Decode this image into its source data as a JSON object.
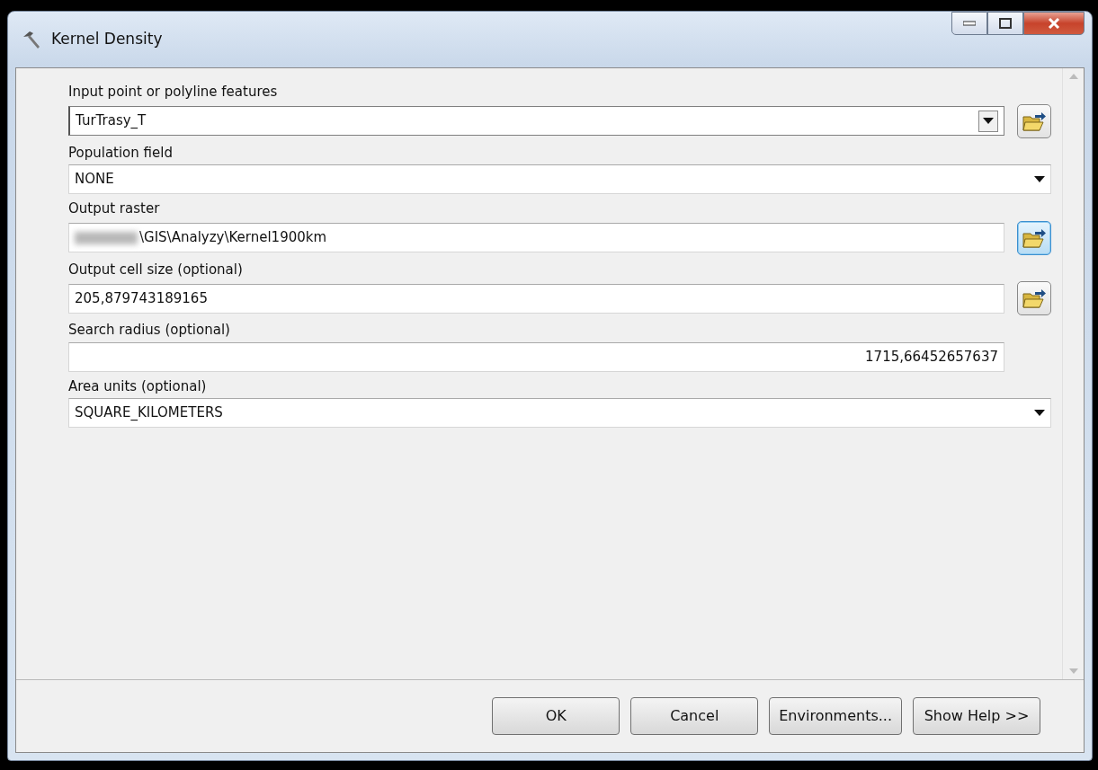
{
  "window": {
    "title": "Kernel Density"
  },
  "parameters": [
    {
      "label": "Input point or polyline features",
      "kind": "combo",
      "value": "TurTrasy_T",
      "browse": true,
      "browse_highlighted": false
    },
    {
      "label": "Population field",
      "kind": "dropdown",
      "value": "NONE"
    },
    {
      "label": "Output raster",
      "kind": "text",
      "value": "\\GIS\\Analyzy\\Kernel1900km",
      "browse": true,
      "browse_highlighted": true,
      "redacted_prefix": true
    },
    {
      "label": "Output cell size (optional)",
      "kind": "text",
      "value": "205,879743189165",
      "browse": true,
      "browse_highlighted": false
    },
    {
      "label": "Search radius (optional)",
      "kind": "number",
      "value": "1715,66452657637"
    },
    {
      "label": "Area units (optional)",
      "kind": "dropdown",
      "value": "SQUARE_KILOMETERS"
    }
  ],
  "buttons": [
    {
      "label": "OK"
    },
    {
      "label": "Cancel"
    },
    {
      "label": "Environments..."
    },
    {
      "label": "Show Help >>"
    }
  ]
}
